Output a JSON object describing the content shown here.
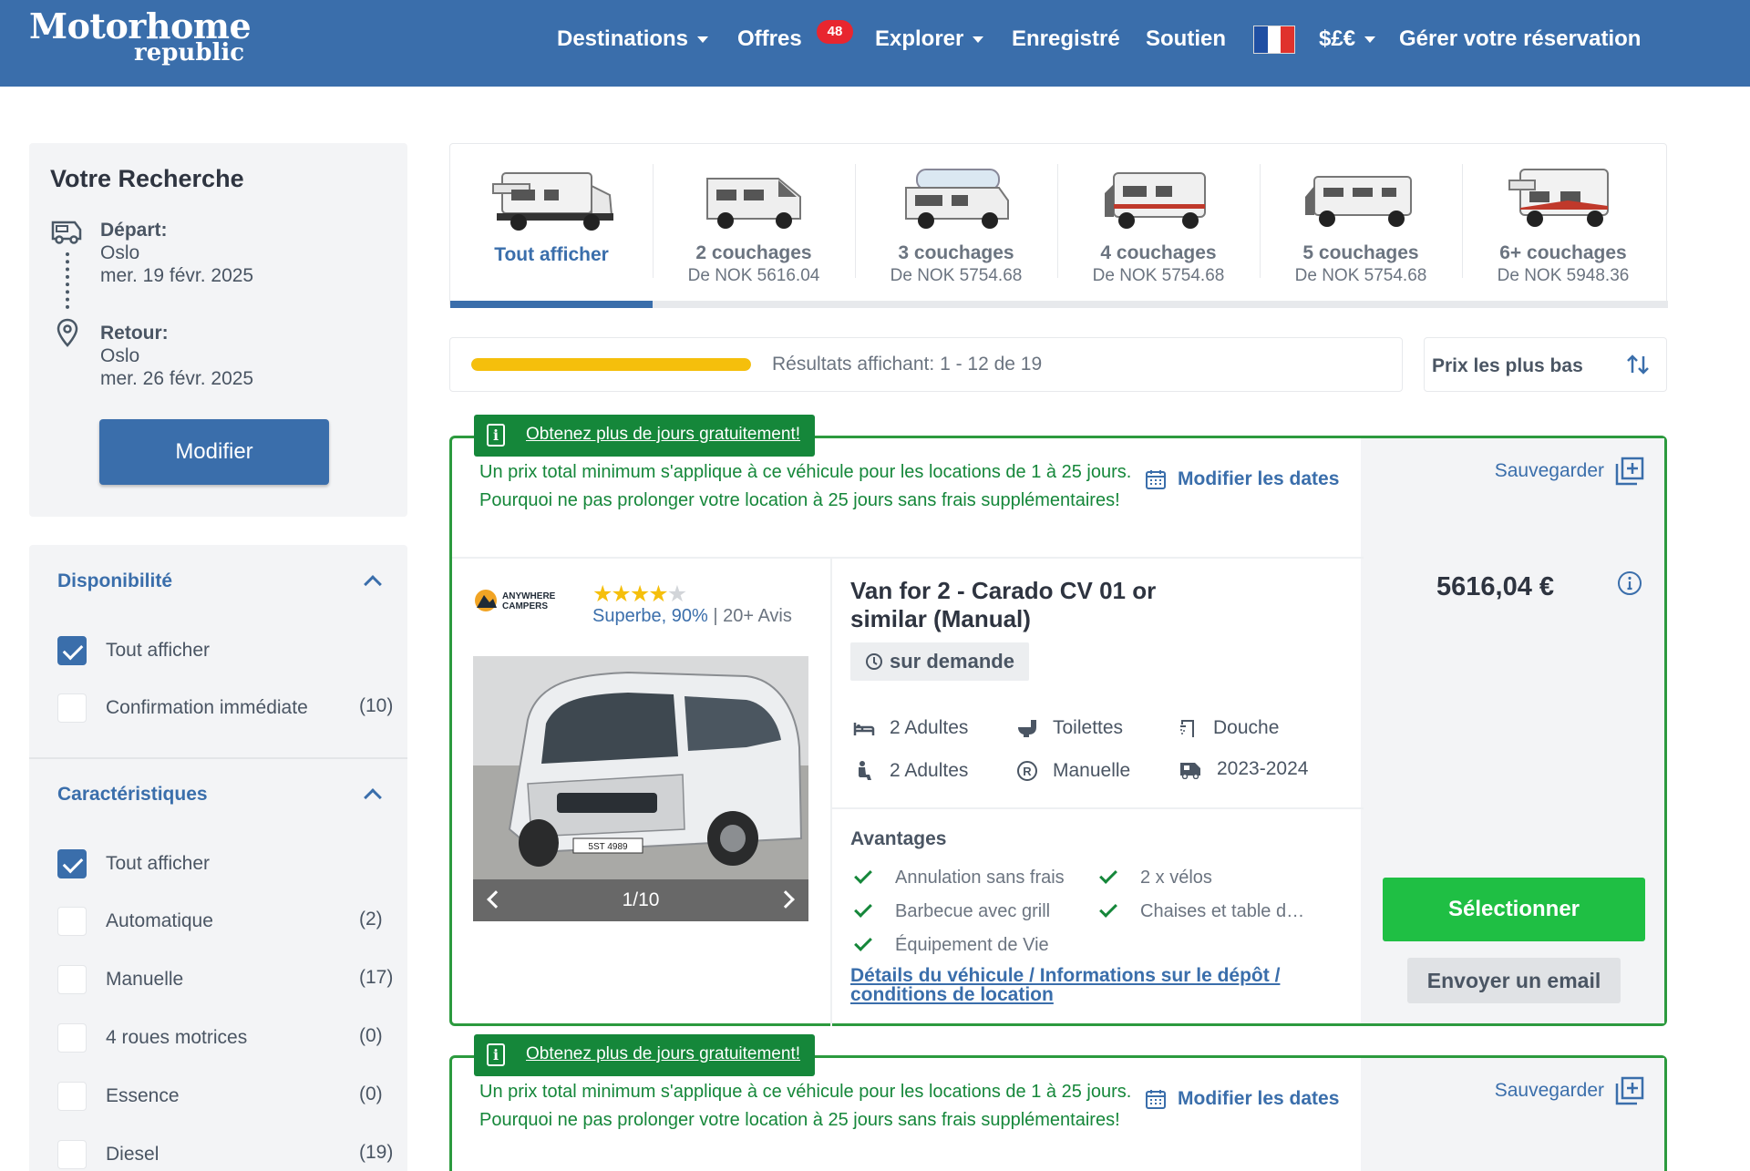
{
  "header": {
    "logo_top": "Motorhome",
    "logo_bottom": "republic",
    "nav": {
      "destinations": "Destinations",
      "offers": "Offres",
      "offers_badge": "48",
      "explore": "Explorer",
      "saved": "Enregistré",
      "support": "Soutien",
      "currency": "$£€",
      "manage": "Gérer votre réservation"
    },
    "flag_colors": [
      "#1f4fa3",
      "#ffffff",
      "#e0322c"
    ]
  },
  "search": {
    "title": "Votre Recherche",
    "departure_label": "Départ:",
    "departure_city": "Oslo",
    "departure_date": "mer. 19 févr. 2025",
    "return_label": "Retour:",
    "return_city": "Oslo",
    "return_date": "mer. 26 févr. 2025",
    "modify_button": "Modifier"
  },
  "filters": {
    "availability": {
      "title": "Disponibilité",
      "items": [
        {
          "label": "Tout afficher",
          "count": "",
          "checked": true
        },
        {
          "label": "Confirmation immédiate",
          "count": "(10)",
          "checked": false
        }
      ]
    },
    "features": {
      "title": "Caractéristiques",
      "items": [
        {
          "label": "Tout afficher",
          "count": "",
          "checked": true
        },
        {
          "label": "Automatique",
          "count": "(2)",
          "checked": false
        },
        {
          "label": "Manuelle",
          "count": "(17)",
          "checked": false
        },
        {
          "label": "4 roues motrices",
          "count": "(0)",
          "checked": false
        },
        {
          "label": "Essence",
          "count": "(0)",
          "checked": false
        },
        {
          "label": "Diesel",
          "count": "(19)",
          "checked": false
        }
      ]
    }
  },
  "categories": [
    {
      "name": "Tout afficher",
      "price": "",
      "active": true
    },
    {
      "name": "2 couchages",
      "price": "De NOK 5616.04",
      "active": false
    },
    {
      "name": "3 couchages",
      "price": "De NOK 5754.68",
      "active": false
    },
    {
      "name": "4 couchages",
      "price": "De NOK 5754.68",
      "active": false
    },
    {
      "name": "5 couchages",
      "price": "De NOK 5754.68",
      "active": false
    },
    {
      "name": "6+ couchages",
      "price": "De NOK 5948.36",
      "active": false
    }
  ],
  "results": {
    "label": "Résultats affichant:",
    "range": "1 - 12 de 19",
    "progress_fraction": 1.0,
    "progress_color": "#f5bf0c",
    "sort_label": "Prix les plus bas"
  },
  "listing": {
    "promo_tab": "Obtenez plus de jours gratuitement!",
    "promo_line1": "Un prix total minimum s'applique à ce véhicule pour les locations de 1 à 25 jours.",
    "promo_line2": "Pourquoi ne pas prolonger votre location à 25 jours sans frais supplémentaires!",
    "modify_dates": "Modifier les dates",
    "save": "Sauvegarder",
    "brand_line1": "ANYWHERE",
    "brand_line2": "CAMPERS",
    "stars": 4,
    "rating_text": "Superbe, 90%",
    "reviews": "20+ Avis",
    "photo_counter": "1/10",
    "photo_plate": "5ST 4989",
    "title": "Van for 2 - Carado CV 01 or similar (Manual)",
    "availability": "sur demande",
    "features": [
      {
        "icon": "bed-icon",
        "label": "2 Adultes"
      },
      {
        "icon": "toilet-icon",
        "label": "Toilettes"
      },
      {
        "icon": "shower-icon",
        "label": "Douche"
      },
      {
        "icon": "seat-icon",
        "label": "2 Adultes"
      },
      {
        "icon": "gearbox-icon",
        "label": "Manuelle"
      },
      {
        "icon": "vehicle-year-icon",
        "label": "2023-2024"
      }
    ],
    "advantages_title": "Avantages",
    "advantages": [
      "Annulation sans frais",
      "2 x vélos",
      "Barbecue avec grill",
      "Chaises et table d…",
      "Équipement de Vie"
    ],
    "details_link": "Détails du véhicule / Informations sur le dépôt / conditions de location",
    "price": "5616,04 €",
    "select_button": "Sélectionner",
    "email_button": "Envoyer un email"
  },
  "listing2": {
    "promo_tab": "Obtenez plus de jours gratuitement!",
    "promo_line1": "Un prix total minimum s'applique à ce véhicule pour les locations de 1 à 25 jours.",
    "promo_line2": "Pourquoi ne pas prolonger votre location à 25 jours sans frais supplémentaires!",
    "modify_dates": "Modifier les dates",
    "save": "Sauvegarder"
  },
  "colors": {
    "brand_blue": "#3a6eab",
    "promo_green": "#15873a",
    "select_green": "#1fbf44",
    "badge_red": "#e8262f",
    "star_yellow": "#f5bf0c"
  }
}
